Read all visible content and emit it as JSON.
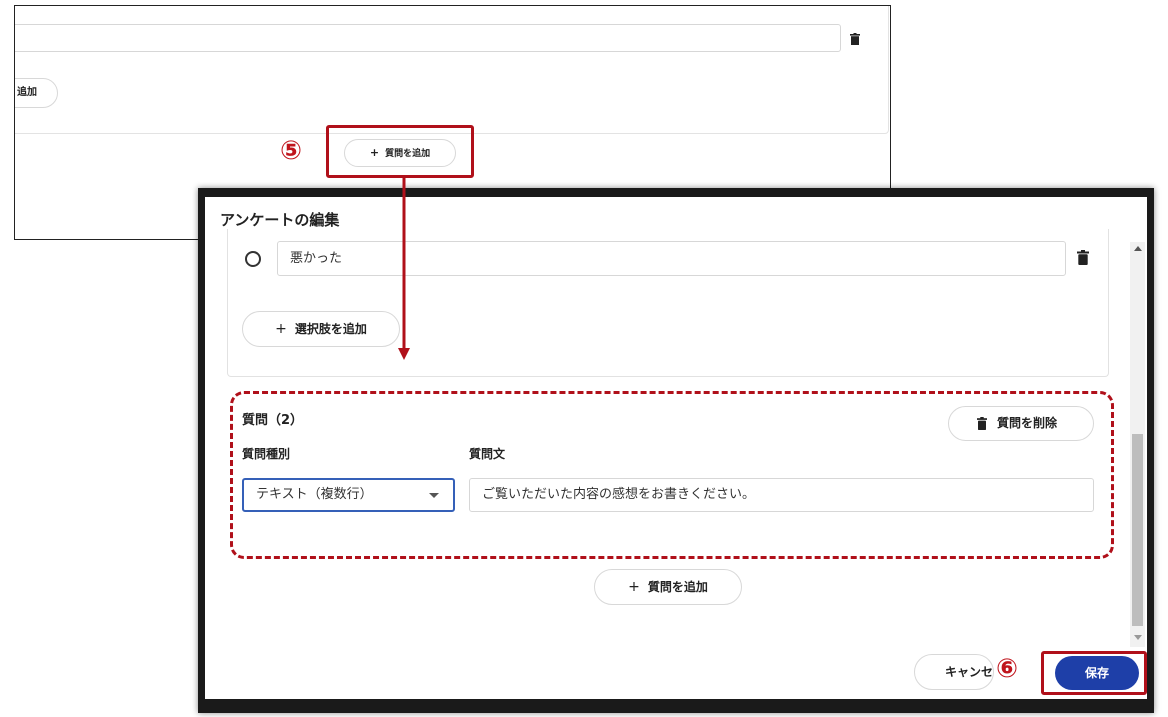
{
  "background_view": {
    "add_option_partial": "追加",
    "add_question_label": "質問を追加",
    "plus_glyph": "+"
  },
  "annotations": {
    "step_5": "⑤",
    "step_6": "⑥"
  },
  "dialog": {
    "title": "アンケートの編集",
    "question1": {
      "option_value": "悪かった",
      "add_option_label": "選択肢を追加"
    },
    "question2": {
      "title": "質問（2）",
      "delete_label": "質問を削除",
      "type_label": "質問種別",
      "type_value": "テキスト（複数行）",
      "text_label": "質問文",
      "text_value": "ご覧いただいた内容の感想をお書きください。"
    },
    "add_question_label": "質問を追加",
    "cancel_label": "キャンセル",
    "save_label": "保存"
  },
  "colors": {
    "annotation_red": "#b0101a",
    "save_button": "#1e3fa8",
    "select_focus": "#3560b8"
  },
  "icons": [
    "trash-icon",
    "plus-icon",
    "radio-icon",
    "chevron-down-icon",
    "arrow-down-icon"
  ]
}
